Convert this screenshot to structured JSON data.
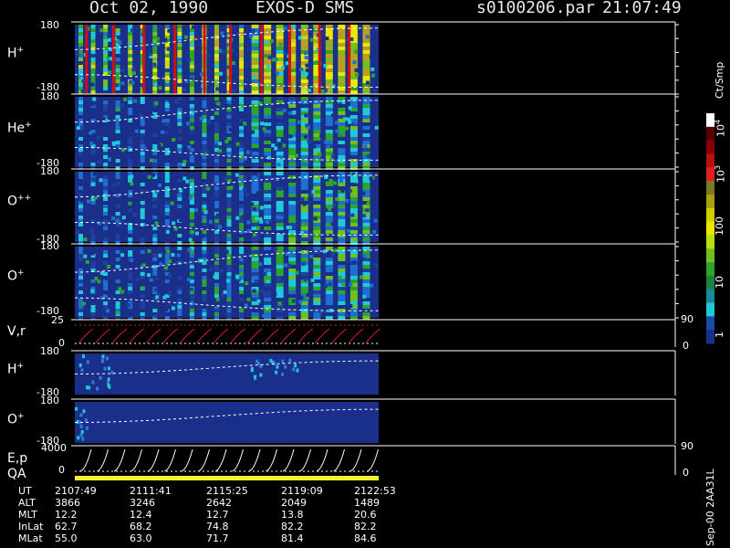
{
  "header": {
    "date": "Oct 02, 1990",
    "instrument": "EXOS-D SMS",
    "file": "s0100206.par",
    "time": "21:07:49"
  },
  "panels": [
    {
      "species": "H",
      "charge": "+",
      "top": "180",
      "bottom": "-180"
    },
    {
      "species": "He",
      "charge": "+",
      "top": "180",
      "bottom": "-180"
    },
    {
      "species": "O",
      "charge": "++",
      "top": "180",
      "bottom": "-180"
    },
    {
      "species": "O",
      "charge": "+",
      "top": "180",
      "bottom": "-180"
    }
  ],
  "vr_panel": {
    "label": "V,r",
    "top": "25",
    "zero": "0",
    "right_top": "90",
    "right_bottom": "0"
  },
  "lower_panels": [
    {
      "species": "H",
      "charge": "+",
      "top": "180",
      "bottom": "-180"
    },
    {
      "species": "O",
      "charge": "+",
      "top": "180",
      "bottom": "-180"
    }
  ],
  "ep_panel": {
    "label": "E,p",
    "top": "4000",
    "zero": "0",
    "right_top": "90",
    "right_bottom": "0"
  },
  "qa_label": "QA",
  "colorbar": {
    "unit": "Ct/Smp",
    "labels": [
      "10",
      "10",
      "100",
      "10",
      "1"
    ],
    "exponents": [
      "4",
      "3",
      "",
      "",
      ""
    ]
  },
  "footer": {
    "rows": [
      {
        "name": "UT",
        "values": [
          "2107:49",
          "2111:41",
          "2115:25",
          "2119:09",
          "2122:53"
        ]
      },
      {
        "name": "ALT",
        "values": [
          "3866",
          "3246",
          "2642",
          "2049",
          "1489"
        ]
      },
      {
        "name": "MLT",
        "values": [
          "12.2",
          "12.4",
          "12.7",
          "13.8",
          "20.6"
        ]
      },
      {
        "name": "InLat",
        "values": [
          "62.7",
          "68.2",
          "74.8",
          "82.2",
          "82.2"
        ]
      },
      {
        "name": "MLat",
        "values": [
          "55.0",
          "63.0",
          "71.7",
          "81.4",
          "84.6"
        ]
      }
    ],
    "stamp": "Sep-00 2AA31L"
  },
  "colors": {
    "background": "#000000",
    "navy": "#1a2f8a",
    "green": "#2da52d",
    "yellow": "#e8e800",
    "red": "#d01010",
    "cyan": "#20c8d8",
    "qa_bar": "#f5f030"
  }
}
